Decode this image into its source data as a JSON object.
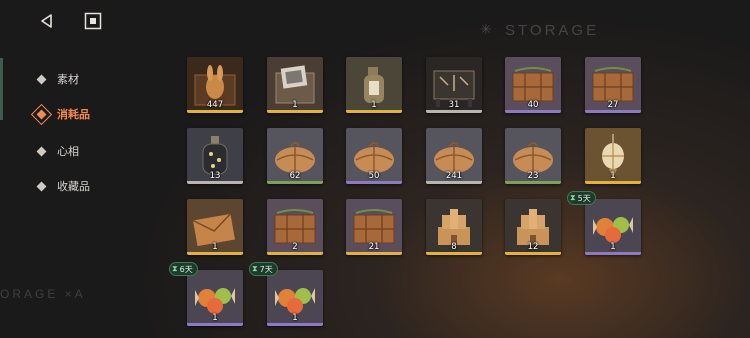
{
  "header": {
    "storage_text": "STORAGE",
    "storage_text_left": "ORAGE ×A"
  },
  "nav": {
    "items": [
      {
        "label": "素材",
        "active": false
      },
      {
        "label": "消耗品",
        "active": true
      },
      {
        "label": "心相",
        "active": false
      },
      {
        "label": "收藏品",
        "active": false
      }
    ]
  },
  "rarity_colors": {
    "gold": "#e3b23c",
    "silver": "#b8b4ae",
    "purple": "#8d7ac2",
    "green": "#7fa05a"
  },
  "items": [
    {
      "name": "rabbit-box-item",
      "count": "447",
      "rarity": "gold"
    },
    {
      "name": "photo-box-item",
      "count": "1",
      "rarity": "gold"
    },
    {
      "name": "message-bottle-item",
      "count": "1",
      "rarity": "gold"
    },
    {
      "name": "ornate-chest-item",
      "count": "31",
      "rarity": "silver"
    },
    {
      "name": "wooden-crate-item",
      "count": "40",
      "rarity": "purple"
    },
    {
      "name": "wooden-crate-item",
      "count": "27",
      "rarity": "purple"
    },
    {
      "name": "star-bottle-item",
      "count": "13",
      "rarity": "silver"
    },
    {
      "name": "sack-item",
      "count": "62",
      "rarity": "green"
    },
    {
      "name": "sack-item",
      "count": "50",
      "rarity": "purple"
    },
    {
      "name": "sack-item",
      "count": "241",
      "rarity": "silver"
    },
    {
      "name": "sack-item",
      "count": "23",
      "rarity": "green"
    },
    {
      "name": "lantern-charm-item",
      "count": "1",
      "rarity": "gold"
    },
    {
      "name": "envelope-item",
      "count": "1",
      "rarity": "gold"
    },
    {
      "name": "wooden-crate-item",
      "count": "2",
      "rarity": "gold"
    },
    {
      "name": "wooden-crate-item",
      "count": "21",
      "rarity": "gold"
    },
    {
      "name": "sand-castle-item",
      "count": "8",
      "rarity": "gold"
    },
    {
      "name": "sand-castle-item",
      "count": "12",
      "rarity": "gold"
    },
    {
      "name": "candy-item",
      "count": "1",
      "rarity": "purple",
      "timer": "5天"
    },
    {
      "name": "candy-item",
      "count": "1",
      "rarity": "purple",
      "timer": "6天"
    },
    {
      "name": "candy-item",
      "count": "1",
      "rarity": "purple",
      "timer": "7天"
    }
  ]
}
